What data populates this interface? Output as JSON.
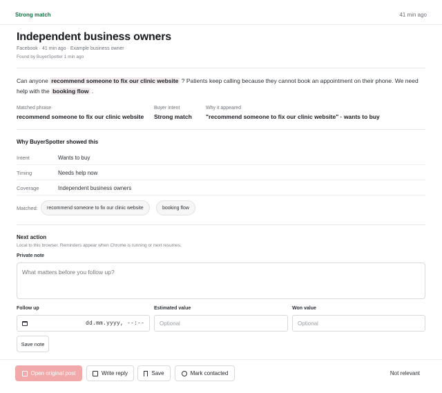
{
  "header": {
    "badge": "Strong match",
    "time_ago": "41 min ago"
  },
  "lead": {
    "title": "Independent business owners",
    "meta": "Facebook · 41 min ago · Example business owner",
    "found": "Found by BuyerSpotter 1 min ago"
  },
  "post": {
    "part1": "Can anyone ",
    "highlight1": "recommend someone to fix our clinic website",
    "part2": " ? Patients keep calling because they cannot book an appointment on their phone. We need help with the ",
    "highlight2": "booking flow",
    "part3": " ."
  },
  "summary": {
    "matched_phrase_label": "Matched phrase",
    "matched_phrase_value": "recommend someone to fix our clinic website",
    "buyer_intent_label": "Buyer intent",
    "buyer_intent_value": "Strong match",
    "why_label": "Why it appeared",
    "why_value": "\"recommend someone to fix our clinic website\" · wants to buy"
  },
  "why_section": {
    "title": "Why BuyerSpotter showed this",
    "rows": [
      {
        "label": "Intent",
        "value": "Wants to buy"
      },
      {
        "label": "Timing",
        "value": "Needs help now"
      },
      {
        "label": "Coverage",
        "value": "Independent business owners"
      }
    ],
    "matched_label": "Matched:",
    "chips": [
      "recommend someone to fix our clinic website",
      "booking flow"
    ]
  },
  "next_action": {
    "title": "Next action",
    "subtitle": "Local to this browser. Reminders appear when Chrome is running or next resumes.",
    "private_note_label": "Private note",
    "private_note_placeholder": "What matters before you follow up?",
    "follow_up_label": "Follow up",
    "follow_up_value": "dd.mm.yyyy, --:--",
    "estimated_value_label": "Estimated value",
    "estimated_value_placeholder": "Optional",
    "won_value_label": "Won value",
    "won_value_placeholder": "Optional",
    "save_note": "Save note"
  },
  "actions": {
    "open_post": "Open original post",
    "write_reply": "Write reply",
    "save": "Save",
    "mark_contacted": "Mark contacted",
    "not_relevant": "Not relevant"
  },
  "colors": {
    "accent_green": "#177245",
    "primary_button": "#f1aaa9",
    "highlight_bg": "#f3ecee"
  },
  "icons": {
    "open_post": "external-link-icon",
    "write_reply": "edit-icon",
    "save": "bookmark-icon",
    "mark_contacted": "check-circle-icon",
    "follow_up": "calendar-icon"
  }
}
